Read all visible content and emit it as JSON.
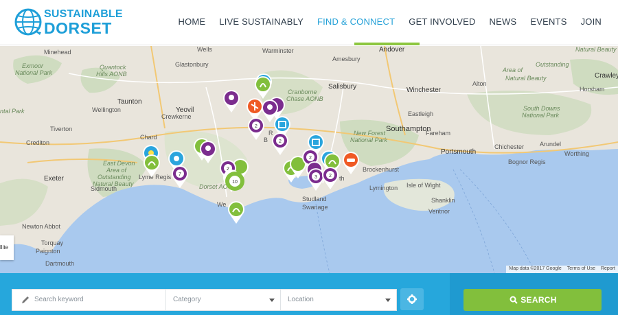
{
  "brand": {
    "line1": "SUSTAINABLE",
    "line2": "DORSET"
  },
  "nav": {
    "items": [
      {
        "label": "HOME"
      },
      {
        "label": "LIVE SUSTAINABLY"
      },
      {
        "label": "FIND & CONNECT",
        "active": true
      },
      {
        "label": "GET INVOLVED"
      },
      {
        "label": "NEWS"
      },
      {
        "label": "EVENTS"
      },
      {
        "label": "JOIN"
      }
    ]
  },
  "colors": {
    "brand_blue": "#1e9fd8",
    "active_nav": "#23a0d7",
    "accent_green": "#8dc63f",
    "search_bar": "#26a7dc",
    "pin_purple": "#7b2d8e",
    "pin_green": "#82bf3c",
    "pin_blue": "#2aa5dd",
    "pin_orange": "#ef5a24"
  },
  "map": {
    "places": {
      "minehead": "Minehead",
      "exmoor": "Exmoor",
      "exmoor2": "National Park",
      "wells": "Wells",
      "warminster": "Warminster",
      "andover": "Andover",
      "quantock": "Quantock",
      "quantock2": "Hills AONB",
      "glastonbury": "Glastonbury",
      "amesbury": "Amesbury",
      "cranborne": "Cranborne",
      "cranborne2": "Chase AONB",
      "salisbury": "Salisbury",
      "winchester": "Winchester",
      "taunton": "Taunton",
      "wellington": "Wellington",
      "yeovil": "Yeovil",
      "eastleigh": "Eastleigh",
      "crewkerne": "Crewkerne",
      "tiverton": "Tiverton",
      "chard": "Chard",
      "southampton": "Southampton",
      "newforest": "New Forest",
      "newforest2": "National Park",
      "crediton": "Crediton",
      "eastdevon": "East Devon",
      "eastdevon2": "Area of",
      "eastdevon3": "Outstanding",
      "eastdevon4": "Natural Beauty",
      "exeter": "Exeter",
      "lymeregis": "Lyme Regis",
      "sidmouth": "Sidmouth",
      "dorsetaonb": "Dorset AO",
      "brockenhurst": "Brockenhurst",
      "lymington": "Lymington",
      "fareham": "Fareham",
      "portsmouth": "Portsmouth",
      "chichester": "Chichester",
      "bognor": "Bognor Regis",
      "studland": "Studland",
      "swanage": "Swanage",
      "isleofwight": "Isle of Wight",
      "shanklin": "Shanklin",
      "ventnor": "Ventnor",
      "newtonabbot": "Newton Abbot",
      "torquay": "Torquay",
      "paignton": "Paignton",
      "dartmouth": "Dartmouth",
      "alton": "Alton",
      "crawley": "Crawley",
      "horsham": "Horsham",
      "southdowns": "South Downs",
      "southdowns2": "National Park",
      "arundel": "Arundel",
      "worthing": "Worthing",
      "naturalbeauty": "Natural Beauty",
      "outstanding": "Outstanding",
      "areaof": "Area of",
      "naturalbeauty2": "Natural Beauty",
      "wey": "We",
      "th": "th",
      "b": "B",
      "r": "R",
      "ntp": "ntal Park"
    },
    "clusters": [
      {
        "count": "2"
      },
      {
        "count": "2"
      },
      {
        "count": "2"
      },
      {
        "count": "2"
      },
      {
        "count": "7"
      },
      {
        "count": "10"
      },
      {
        "count": "2"
      },
      {
        "count": "3"
      },
      {
        "count": "2"
      }
    ],
    "satellite_label": "llite",
    "footer": {
      "data": "Map data ©2017 Google",
      "terms": "Terms of Use",
      "report": "Report"
    }
  },
  "search": {
    "keyword_placeholder": "Search keyword",
    "category_placeholder": "Category",
    "location_placeholder": "Location",
    "button_label": "SEARCH"
  }
}
